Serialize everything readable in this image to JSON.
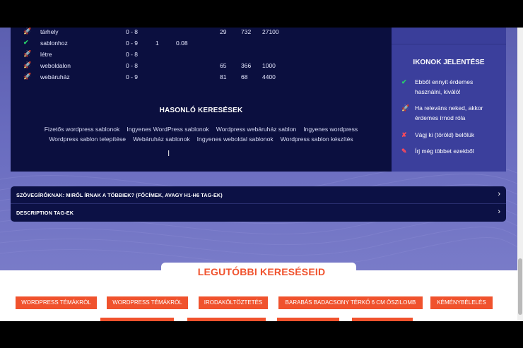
{
  "keywords": [
    {
      "icon": "rocket-icon",
      "glyph": "🚀",
      "name": "tárhely",
      "difficulty": "0 - 8",
      "col1": "",
      "col2": "",
      "col3": "29",
      "col4": "732",
      "col5": "27100"
    },
    {
      "icon": "check-icon",
      "glyph": "✔",
      "name": "sablonhoz",
      "difficulty": "0 - 9",
      "col1": "1",
      "col2": "0.08",
      "col3": "",
      "col4": "",
      "col5": ""
    },
    {
      "icon": "rocket-icon",
      "glyph": "🚀",
      "name": "létre",
      "difficulty": "0 - 8",
      "col1": "",
      "col2": "",
      "col3": "",
      "col4": "",
      "col5": ""
    },
    {
      "icon": "rocket-icon",
      "glyph": "🚀",
      "name": "weboldalon",
      "difficulty": "0 - 8",
      "col1": "",
      "col2": "",
      "col3": "65",
      "col4": "366",
      "col5": "1000"
    },
    {
      "icon": "rocket-icon",
      "glyph": "🚀",
      "name": "webáruház",
      "difficulty": "0 - 9",
      "col1": "",
      "col2": "",
      "col3": "81",
      "col4": "68",
      "col5": "4400"
    }
  ],
  "similar": {
    "title": "HASONLÓ KERESÉSEK",
    "links": [
      "Fizetős wordpress sablonok",
      "Ingyenes WordPress sablonok",
      "Wordpress webáruház sablon",
      "Ingyenes wordpress",
      "Wordpress sablon telepítése",
      "Webáruház sablonok",
      "Ingyenes weboldal sablonok",
      "Wordpress sablon készítés"
    ]
  },
  "legend": {
    "title": "IKONOK JELENTÉSE",
    "items": [
      {
        "icon": "check-icon",
        "glyph": "✔",
        "text": "Ebből ennyit érdemes használni, kiváló!"
      },
      {
        "icon": "rocket-icon",
        "glyph": "🚀",
        "text": "Ha releváns neked, akkor érdemes írnod róla"
      },
      {
        "icon": "cross-icon",
        "glyph": "✘",
        "text": "Vágj ki (töröld) belőlük"
      },
      {
        "icon": "pencil-icon",
        "glyph": "✎",
        "text": "Írj még többet ezekből"
      }
    ]
  },
  "accordion": {
    "items": [
      {
        "label": "SZÖVEGÍRÓKNAK: MIRŐL ÍRNAK A TÖBBIEK? (FŐCÍMEK, AVAGY H1-H6 TAG-EK)",
        "chevron": "›"
      },
      {
        "label": "DESCRIPTION TAG-EK",
        "chevron": "›"
      }
    ]
  },
  "recent": {
    "title": "LEGUTÓBBI KERESÉSEID",
    "tags": [
      "WORDPRESS TÉMÁKRÓL",
      "WORDPRESS TÉMÁKRÓL",
      "IRODAKÖLTÖZTETÉS",
      "BARABÁS BADACSONY TÉRKŐ 6 CM ÖSZILOMB",
      "KÉMÉNYBÉLELÉS"
    ]
  },
  "colors": {
    "panel": "#0b0f3f",
    "side": "#3b3f9c",
    "accent": "#f0522d",
    "check": "#27d16a",
    "cross": "#ff4a5a"
  }
}
